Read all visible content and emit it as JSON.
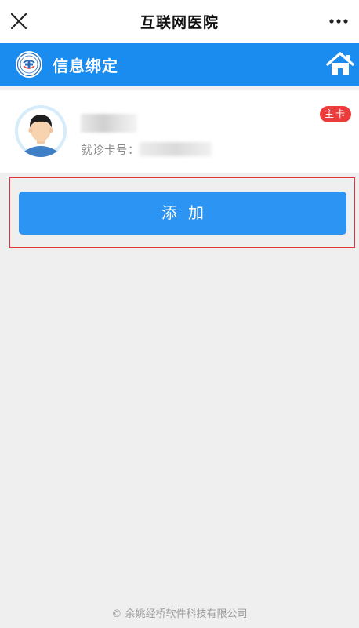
{
  "topbar": {
    "title": "互联网医院",
    "close_icon": "close-icon",
    "more_icon": "more-icon"
  },
  "header": {
    "title": "信息绑定",
    "logo_icon": "hospital-logo-icon",
    "home_icon": "home-icon"
  },
  "card": {
    "avatar_icon": "avatar-icon",
    "card_no_label": "就诊卡号：",
    "badge": "主卡"
  },
  "actions": {
    "add_label": "添加"
  },
  "footer": {
    "copyright": "© 余姚经桥软件科技有限公司"
  },
  "colors": {
    "header_blue": "#1a8cf0",
    "button_blue": "#2c94f3",
    "badge_red": "#ec3b3b",
    "highlight_red": "#e5363a",
    "page_bg": "#efefef"
  }
}
